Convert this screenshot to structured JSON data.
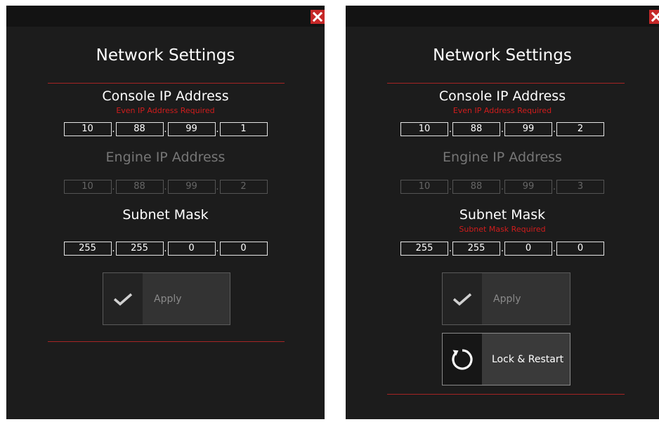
{
  "panels": [
    {
      "title": "Network Settings",
      "console": {
        "label": "Console IP Address",
        "hint": "Even IP Address Required",
        "octets": [
          "10",
          "88",
          "99",
          "1"
        ]
      },
      "engine": {
        "label": "Engine IP Address",
        "octets": [
          "10",
          "88",
          "99",
          "2"
        ]
      },
      "subnet": {
        "label": "Subnet Mask",
        "octets": [
          "255",
          "255",
          "0",
          "0"
        ]
      },
      "apply_label": "Apply"
    },
    {
      "title": "Network Settings",
      "console": {
        "label": "Console IP Address",
        "hint": "Even IP Address Required",
        "octets": [
          "10",
          "88",
          "99",
          "2"
        ]
      },
      "engine": {
        "label": "Engine IP Address",
        "octets": [
          "10",
          "88",
          "99",
          "3"
        ]
      },
      "subnet": {
        "label": "Subnet Mask",
        "hint": "Subnet Mask Required",
        "octets": [
          "255",
          "255",
          "0",
          "0"
        ]
      },
      "apply_label": "Apply",
      "restart_label": "Lock & Restart"
    }
  ],
  "colors": {
    "panel_bg": "#1c1c1c",
    "accent_red": "#c62828",
    "warning_text": "#d01c1c",
    "divider": "#a52424"
  },
  "icons": {
    "close": "close-icon",
    "apply": "checkmark-icon",
    "restart": "restart-icon"
  }
}
